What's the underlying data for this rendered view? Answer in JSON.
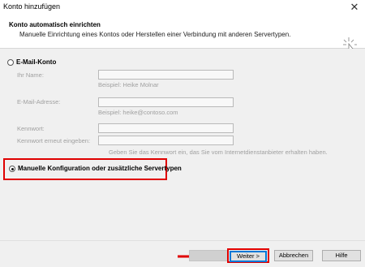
{
  "window": {
    "title": "Konto hinzufügen",
    "close_glyph": "✕"
  },
  "header": {
    "title": "Konto automatisch einrichten",
    "subtitle": "Manuelle Einrichtung eines Kontos oder Herstellen einer Verbindung mit anderen Servertypen."
  },
  "options": {
    "email_account": {
      "label": "E-Mail-Konto",
      "selected": false
    },
    "manual_config": {
      "label": "Manuelle Konfiguration oder zusätzliche Servertypen",
      "selected": true
    }
  },
  "form": {
    "name_label": "Ihr Name:",
    "name_value": "",
    "name_hint": "Beispiel: Heike Molnar",
    "email_label": "E-Mail-Adresse:",
    "email_value": "",
    "email_hint": "Beispiel: heike@contoso.com",
    "password_label": "Kennwort:",
    "password_value": "",
    "password_repeat_label": "Kennwort erneut eingeben:",
    "password_repeat_value": "",
    "password_hint": "Geben Sie das Kennwort ein, das Sie vom Internetdienstanbieter erhalten haben."
  },
  "buttons": {
    "back": "< Zurück",
    "next": "Weiter >",
    "cancel": "Abbrechen",
    "help": "Hilfe"
  },
  "annotations": {
    "highlight_color": "#e00000"
  }
}
